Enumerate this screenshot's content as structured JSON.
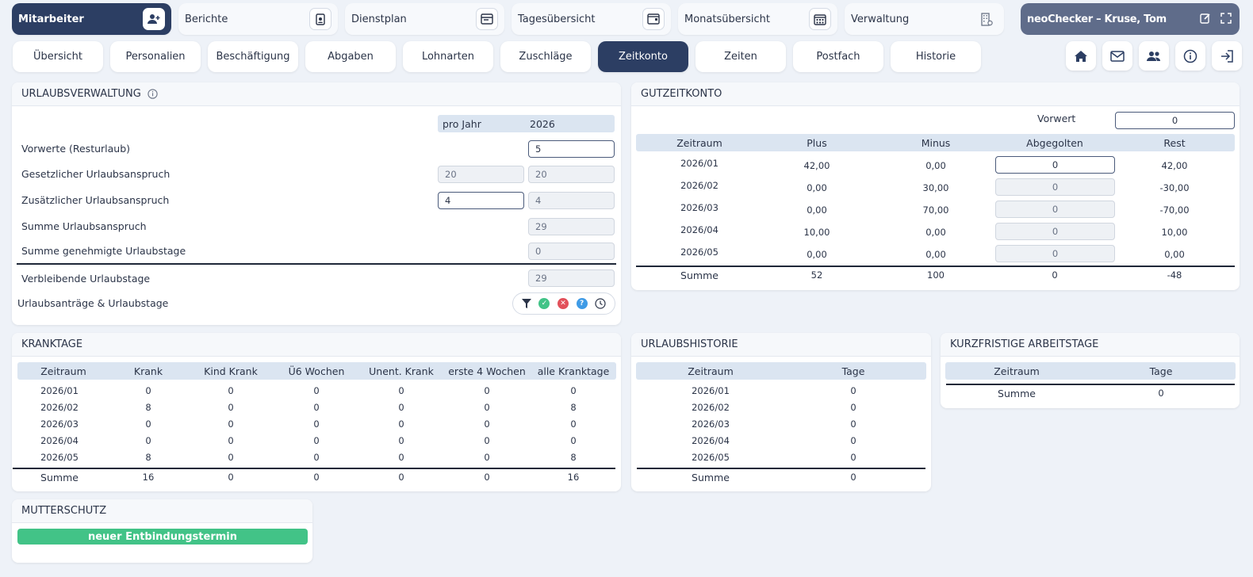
{
  "topnav": [
    {
      "label": "Mitarbeiter",
      "icon": "user-plus-icon"
    },
    {
      "label": "Berichte",
      "icon": "report-icon"
    },
    {
      "label": "Dienstplan",
      "icon": "schedule-icon"
    },
    {
      "label": "Tagesübersicht",
      "icon": "day-view-icon"
    },
    {
      "label": "Monatsübersicht",
      "icon": "calendar-icon"
    },
    {
      "label": "Verwaltung",
      "icon": "building-icon"
    }
  ],
  "user": {
    "label": "neoChecker – Kruse, Tom"
  },
  "tabs": [
    "Übersicht",
    "Personalien",
    "Beschäftigung",
    "Abgaben",
    "Lohnarten",
    "Zuschläge",
    "Zeitkonto",
    "Zeiten",
    "Postfach",
    "Historie"
  ],
  "active_tab": "Zeitkonto",
  "urlaub": {
    "title": "URLAUBSVERWALTUNG",
    "col_jahr": "pro Jahr",
    "col_year": "2026",
    "rows": [
      {
        "label": "Vorwerte (Resturlaub)",
        "jahr": null,
        "year": "5"
      },
      {
        "label": "Gesetzlicher Urlaubsanspruch",
        "jahr": "20",
        "year": "20"
      },
      {
        "label": "Zusätzlicher Urlaubsanspruch",
        "jahr": "4",
        "year": "4"
      },
      {
        "label": "Summe Urlaubsanspruch",
        "jahr": null,
        "year": "29"
      },
      {
        "label": "Summe genehmigte Urlaubstage",
        "jahr": null,
        "year": "0"
      },
      {
        "label": "Verbleibende Urlaubstage",
        "jahr": null,
        "year": "29"
      }
    ],
    "antraege_label": "Urlaubsanträge & Urlaubstage",
    "status_colors": {
      "approved": "#42c387",
      "rejected": "#e2505a",
      "pending": "#3f9be6"
    }
  },
  "gutzeit": {
    "title": "GUTZEITKONTO",
    "vorwert_label": "Vorwert",
    "vorwert_value": "0",
    "headers": [
      "Zeitraum",
      "Plus",
      "Minus",
      "Abgegolten",
      "Rest"
    ],
    "rows": [
      [
        "2026/01",
        "42,00",
        "0,00",
        "0",
        "42,00"
      ],
      [
        "2026/02",
        "0,00",
        "30,00",
        "0",
        "-30,00"
      ],
      [
        "2026/03",
        "0,00",
        "70,00",
        "0",
        "-70,00"
      ],
      [
        "2026/04",
        "10,00",
        "0,00",
        "0",
        "10,00"
      ],
      [
        "2026/05",
        "0,00",
        "0,00",
        "0",
        "0,00"
      ]
    ],
    "sum": [
      "Summe",
      "52",
      "100",
      "0",
      "-48"
    ]
  },
  "krank": {
    "title": "KRANKTAGE",
    "headers": [
      "Zeitraum",
      "Krank",
      "Kind Krank",
      "Ü6 Wochen",
      "Unent. Krank",
      "erste 4 Wochen",
      "alle Kranktage"
    ],
    "rows": [
      [
        "2026/01",
        "0",
        "0",
        "0",
        "0",
        "0",
        "0"
      ],
      [
        "2026/02",
        "8",
        "0",
        "0",
        "0",
        "0",
        "8"
      ],
      [
        "2026/03",
        "0",
        "0",
        "0",
        "0",
        "0",
        "0"
      ],
      [
        "2026/04",
        "0",
        "0",
        "0",
        "0",
        "0",
        "0"
      ],
      [
        "2026/05",
        "8",
        "0",
        "0",
        "0",
        "0",
        "8"
      ]
    ],
    "sum": [
      "Summe",
      "16",
      "0",
      "0",
      "0",
      "0",
      "16"
    ]
  },
  "historie": {
    "title": "URLAUBSHISTORIE",
    "headers": [
      "Zeitraum",
      "Tage"
    ],
    "rows": [
      [
        "2026/01",
        "0"
      ],
      [
        "2026/02",
        "0"
      ],
      [
        "2026/03",
        "0"
      ],
      [
        "2026/04",
        "0"
      ],
      [
        "2026/05",
        "0"
      ]
    ],
    "sum": [
      "Summe",
      "0"
    ]
  },
  "kurz": {
    "title": "KURZFRISTIGE ARBEITSTAGE",
    "headers": [
      "Zeitraum",
      "Tage"
    ],
    "sum": [
      "Summe",
      "0"
    ]
  },
  "mutter": {
    "title": "MUTTERSCHUTZ",
    "button": "neuer Entbindungstermin"
  }
}
